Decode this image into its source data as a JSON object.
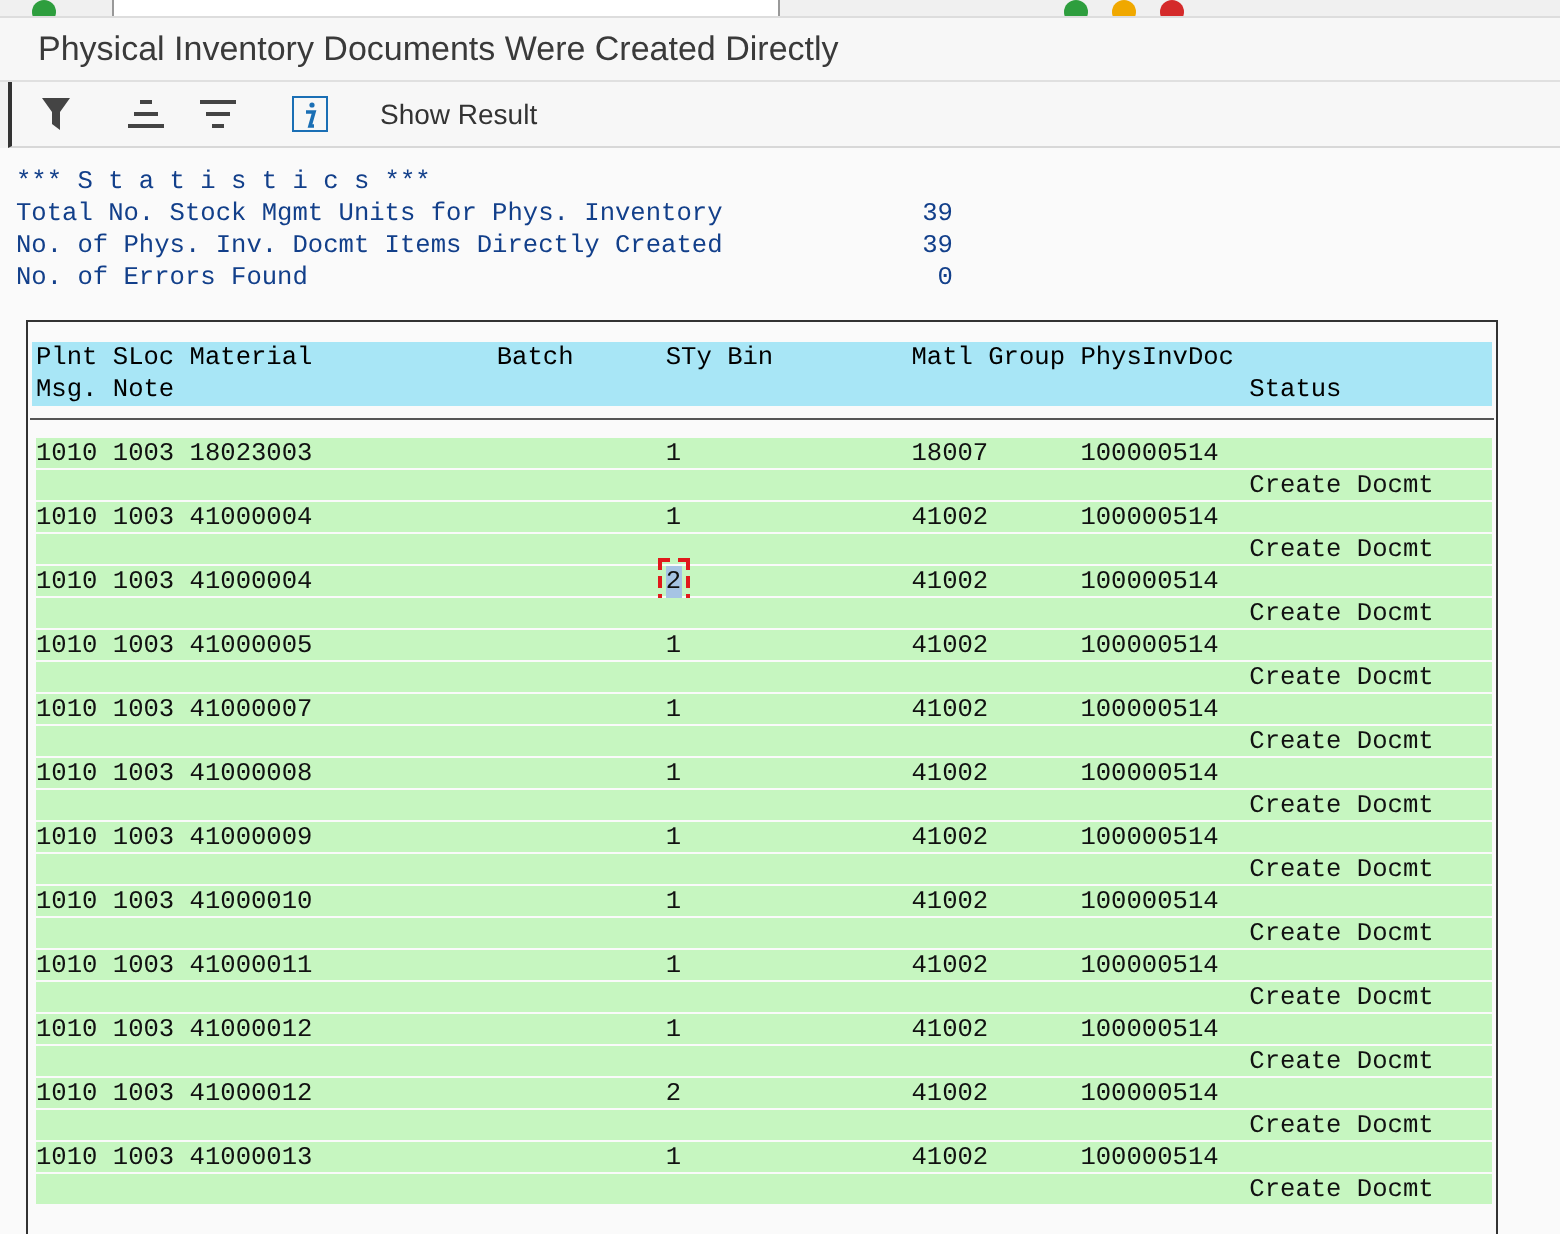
{
  "window": {
    "title": "Physical Inventory Documents Were Created Directly"
  },
  "toolbar": {
    "button_label": "Show Result"
  },
  "statistics": {
    "heading": "*** S t a t i s t i c s ***",
    "lines": [
      {
        "label": "Total No. Stock Mgmt Units for Phys. Inventory",
        "value": "39"
      },
      {
        "label": "No. of Phys. Inv. Docmt Items Directly Created",
        "value": "39"
      },
      {
        "label": "No. of Errors Found",
        "value": "0"
      }
    ]
  },
  "table": {
    "columns": [
      "Plnt",
      "SLoc",
      "Material",
      "Batch",
      "STy",
      "Bin",
      "Matl Group",
      "PhysInvDoc"
    ],
    "columns_line2": [
      "Msg.",
      "Note",
      "Status"
    ],
    "rows": [
      {
        "plnt": "1010",
        "sloc": "1003",
        "material": "18023003",
        "sty": "1",
        "matl_group": "18007",
        "physinvdoc": "100000514",
        "status": "Create Docmt",
        "selected": false
      },
      {
        "plnt": "1010",
        "sloc": "1003",
        "material": "41000004",
        "sty": "1",
        "matl_group": "41002",
        "physinvdoc": "100000514",
        "status": "Create Docmt",
        "selected": false
      },
      {
        "plnt": "1010",
        "sloc": "1003",
        "material": "41000004",
        "sty": "2",
        "matl_group": "41002",
        "physinvdoc": "100000514",
        "status": "Create Docmt",
        "selected": true
      },
      {
        "plnt": "1010",
        "sloc": "1003",
        "material": "41000005",
        "sty": "1",
        "matl_group": "41002",
        "physinvdoc": "100000514",
        "status": "Create Docmt",
        "selected": false
      },
      {
        "plnt": "1010",
        "sloc": "1003",
        "material": "41000007",
        "sty": "1",
        "matl_group": "41002",
        "physinvdoc": "100000514",
        "status": "Create Docmt",
        "selected": false
      },
      {
        "plnt": "1010",
        "sloc": "1003",
        "material": "41000008",
        "sty": "1",
        "matl_group": "41002",
        "physinvdoc": "100000514",
        "status": "Create Docmt",
        "selected": false
      },
      {
        "plnt": "1010",
        "sloc": "1003",
        "material": "41000009",
        "sty": "1",
        "matl_group": "41002",
        "physinvdoc": "100000514",
        "status": "Create Docmt",
        "selected": false
      },
      {
        "plnt": "1010",
        "sloc": "1003",
        "material": "41000010",
        "sty": "1",
        "matl_group": "41002",
        "physinvdoc": "100000514",
        "status": "Create Docmt",
        "selected": false
      },
      {
        "plnt": "1010",
        "sloc": "1003",
        "material": "41000011",
        "sty": "1",
        "matl_group": "41002",
        "physinvdoc": "100000514",
        "status": "Create Docmt",
        "selected": false
      },
      {
        "plnt": "1010",
        "sloc": "1003",
        "material": "41000012",
        "sty": "1",
        "matl_group": "41002",
        "physinvdoc": "100000514",
        "status": "Create Docmt",
        "selected": false
      },
      {
        "plnt": "1010",
        "sloc": "1003",
        "material": "41000012",
        "sty": "2",
        "matl_group": "41002",
        "physinvdoc": "100000514",
        "status": "Create Docmt",
        "selected": false
      },
      {
        "plnt": "1010",
        "sloc": "1003",
        "material": "41000013",
        "sty": "1",
        "matl_group": "41002",
        "physinvdoc": "100000514",
        "status": "Create Docmt",
        "selected": false
      }
    ]
  }
}
